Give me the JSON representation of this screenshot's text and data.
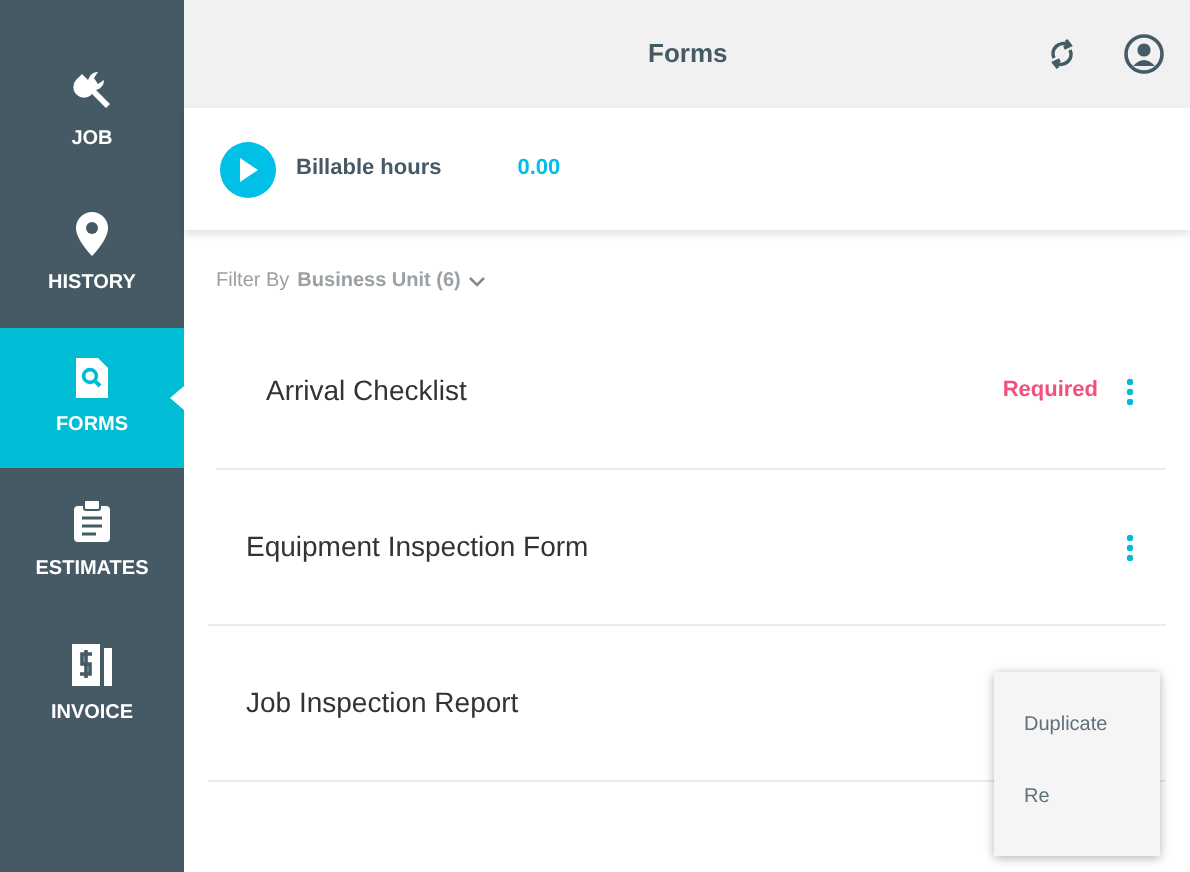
{
  "sidebar": {
    "items": [
      {
        "label": "JOB",
        "selected": false
      },
      {
        "label": "HISTORY",
        "selected": false
      },
      {
        "label": "FORMS",
        "selected": true
      },
      {
        "label": "ESTIMATES",
        "selected": false
      },
      {
        "label": "INVOICE",
        "selected": false
      }
    ]
  },
  "header": {
    "title": "Forms"
  },
  "timer": {
    "label": "Billable hours",
    "value": "0.00"
  },
  "filter": {
    "label": "Filter By",
    "value": "Business Unit (6)"
  },
  "forms": [
    {
      "title": "Arrival Checklist",
      "tag": "Required"
    },
    {
      "title": "Equipment Inspection Form"
    },
    {
      "title": "Job Inspection Report"
    }
  ],
  "menu": {
    "items": [
      "Duplicate",
      "Re"
    ]
  }
}
